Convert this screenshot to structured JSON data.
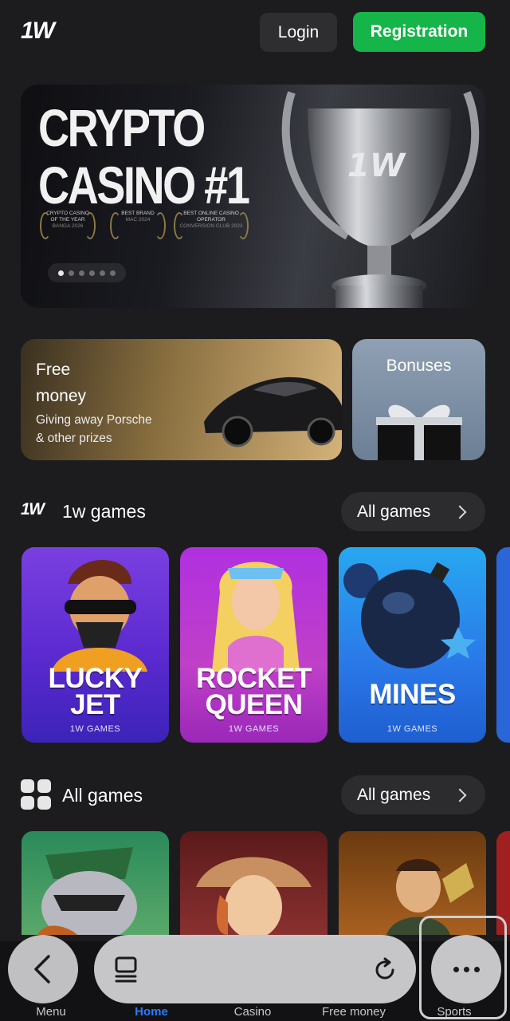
{
  "header": {
    "logo": "1W",
    "login_label": "Login",
    "registration_label": "Registration"
  },
  "hero": {
    "title_line1": "CRYPTO",
    "title_line2": "CASINO #1",
    "awards": [
      {
        "title": "CRYPTO CASINO OF THE YEAR",
        "sub": "BANGA 2026"
      },
      {
        "title": "BEST BRAND",
        "sub": "MAC 2024"
      },
      {
        "title": "BEST ONLINE CASINO OPERATOR",
        "sub": "CONVERSION CLUB 2023"
      }
    ],
    "cup_text": "1W",
    "carousel_dots": 6,
    "active_dot": 0
  },
  "promo": {
    "free_money": {
      "title_line1": "Free",
      "title_line2": "money",
      "desc_line1": "Giving away Porsche",
      "desc_line2": "& other prizes"
    },
    "bonuses": {
      "title": "Bonuses"
    }
  },
  "sections": {
    "games_1w": {
      "title": "1w games",
      "link": "All games",
      "logo": "1W"
    },
    "all_games": {
      "title": "All games",
      "link": "All games"
    }
  },
  "games_1w": [
    {
      "name_line1": "LUCKY",
      "name_line2": "JET",
      "sub": "1W GAMES"
    },
    {
      "name_line1": "ROCKET",
      "name_line2": "QUEEN",
      "sub": "1W GAMES"
    },
    {
      "name_line1": "MINES",
      "name_line2": "",
      "sub": "1W GAMES"
    }
  ],
  "nav": {
    "items": [
      {
        "label": "Menu",
        "active": false
      },
      {
        "label": "Home",
        "active": true
      },
      {
        "label": "Casino",
        "active": false
      },
      {
        "label": "Free money",
        "active": false
      },
      {
        "label": "Sports",
        "active": false
      }
    ]
  },
  "colors": {
    "background": "#1c1c1e",
    "accent_green": "#16b549",
    "active_nav": "#2a7bff"
  }
}
